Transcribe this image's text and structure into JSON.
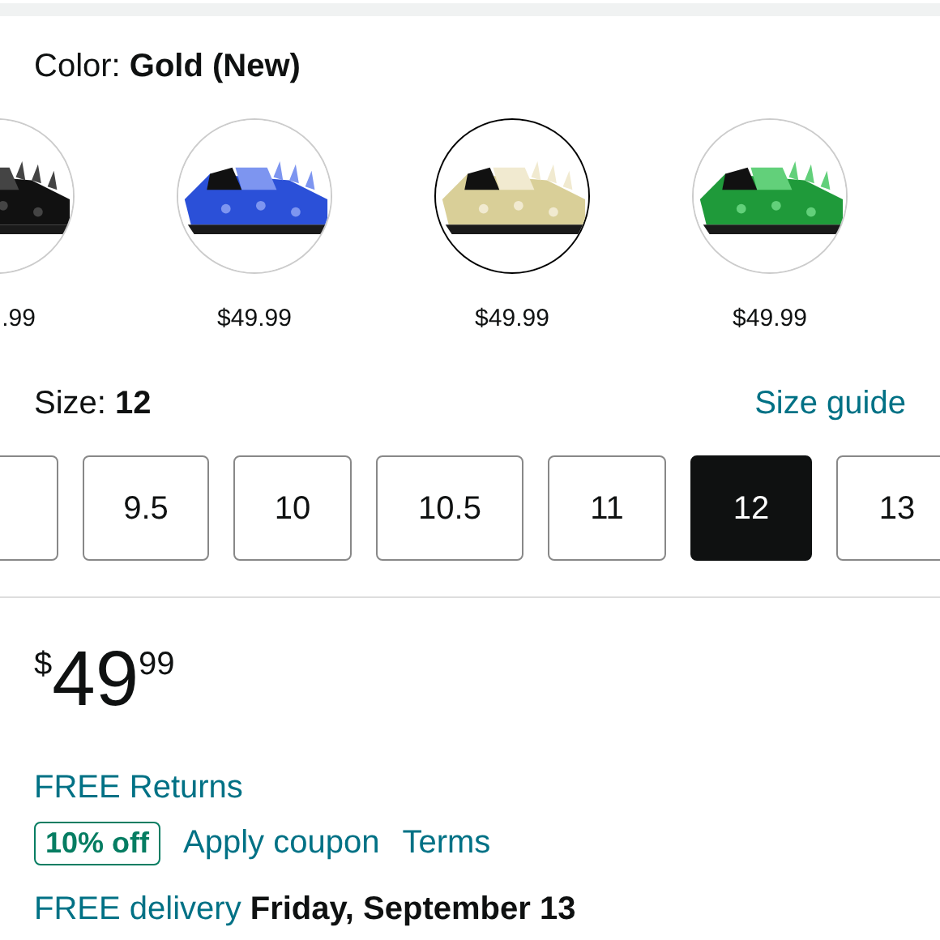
{
  "color_selector": {
    "label": "Color:",
    "value": "Gold (New)"
  },
  "swatches": [
    {
      "price": ".99",
      "selected": false
    },
    {
      "price": "$49.99",
      "selected": false
    },
    {
      "price": "$49.99",
      "selected": true
    },
    {
      "price": "$49.99",
      "selected": false
    }
  ],
  "size_selector": {
    "label": "Size:",
    "value": "12",
    "guide_link": "Size guide"
  },
  "sizes": [
    {
      "selected": false
    },
    {
      "label": "9.5",
      "selected": false
    },
    {
      "label": "10",
      "selected": false
    },
    {
      "label": "10.5",
      "selected": false
    },
    {
      "label": "11",
      "selected": false
    },
    {
      "label": "12",
      "selected": true
    },
    {
      "label": "13",
      "selected": false
    }
  ],
  "price": {
    "symbol": "$",
    "whole": "49",
    "fraction": "99"
  },
  "returns": "FREE Returns",
  "coupon": {
    "badge": "10% off",
    "apply": "Apply coupon",
    "terms": "Terms"
  },
  "delivery": "FREE delivery **Friday, September 13**"
}
